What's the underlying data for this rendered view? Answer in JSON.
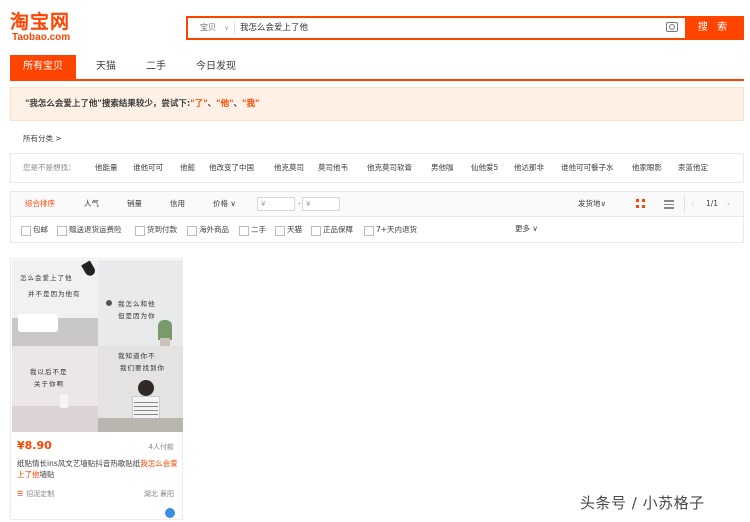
{
  "header": {
    "logo_cn": "淘宝网",
    "logo_en": "Taobao.com",
    "search_scope": "宝贝",
    "search_query": "我怎么会爱上了他",
    "search_button": "搜 索"
  },
  "tabs": [
    {
      "label": "所有宝贝",
      "active": true
    },
    {
      "label": "天猫",
      "active": false
    },
    {
      "label": "二手",
      "active": false
    },
    {
      "label": "今日发现",
      "active": false
    }
  ],
  "notice": {
    "prefix": "\"我怎么会爱上了他\"搜索结果较少，尝试下:",
    "suggestions": [
      "\"了\"",
      "\"他\"",
      "\"我\""
    ],
    "separator": "、"
  },
  "all_categories": "所有分类 >",
  "related": {
    "label": "您是不是想找：",
    "items": [
      "他能量",
      "谁他可可",
      "他懿",
      "他改变了中国",
      "他克莫司",
      "莫司他韦",
      "他克莫司软膏",
      "男他咖",
      "仙他爱5",
      "他达那非",
      "谁他可可餐子水",
      "他家眼影",
      "汞蓝他定"
    ]
  },
  "sort": {
    "items": [
      "综合排序",
      "人气",
      "销量",
      "信用",
      "价格"
    ],
    "price_min_placeholder": "¥",
    "price_max_placeholder": "¥",
    "ship_from": "发货地",
    "pager": "1/1"
  },
  "filters": [
    "包邮",
    "赠送退货运费险",
    "货到付款",
    "海外商品",
    "二手",
    "天猫",
    "正品保障",
    "7+天内退货"
  ],
  "more_label": "更多",
  "product": {
    "price": "¥8.90",
    "sales": "4人付款",
    "title_plain": "纸贴情长ins风文艺墙贴抖音热歌贴纸",
    "title_highlight": "我怎么会爱上了他",
    "title_tail": "墙贴",
    "shop": "招泥定制",
    "location": "湖北 襄阳",
    "image_text": [
      "怎么会爱上了他",
      "并不是因为他有",
      "我怎么和他",
      "但是因为你",
      "我以后不是",
      "关于你啊",
      "我知道你不",
      "我们要找到你"
    ]
  },
  "watermark": "头条号 / 小苏格子"
}
